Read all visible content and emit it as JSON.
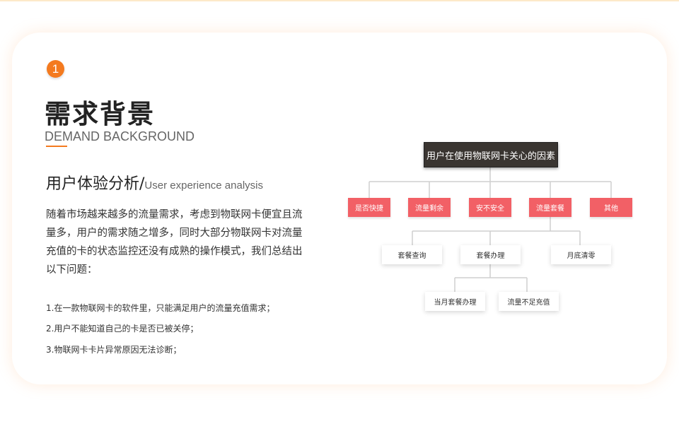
{
  "header": {
    "step_number": "1",
    "title_cn": "需求背景",
    "title_en": "DEMAND BACKGROUND"
  },
  "section": {
    "subtitle_cn": "用户体验分析/",
    "subtitle_en": "User experience analysis",
    "paragraph": "随着市场越来越多的流量需求，考虑到物联网卡便宜且流量多，用户的需求随之增多，同时大部分物联网卡对流量充值的卡的状态监控还没有成熟的操作模式，我们总结出以下问题：",
    "issues": [
      "1.在一款物联网卡的软件里，只能满足用户的流量充值需求；",
      "2.用户不能知道自己的卡是否已被关停；",
      "3.物联网卡卡片异常原因无法诊断；"
    ]
  },
  "diagram": {
    "root": "用户在使用物联网卡关心的因素",
    "level1": [
      "是否快捷",
      "流量剩余",
      "安不安全",
      "流量套餐",
      "其他"
    ],
    "level2": [
      "套餐查询",
      "套餐办理",
      "月底清零"
    ],
    "level3": [
      "当月套餐办理",
      "流量不足充值"
    ]
  },
  "colors": {
    "accent": "#f47a1f",
    "node_red": "#f26066",
    "root_bg": "#3a3531"
  }
}
